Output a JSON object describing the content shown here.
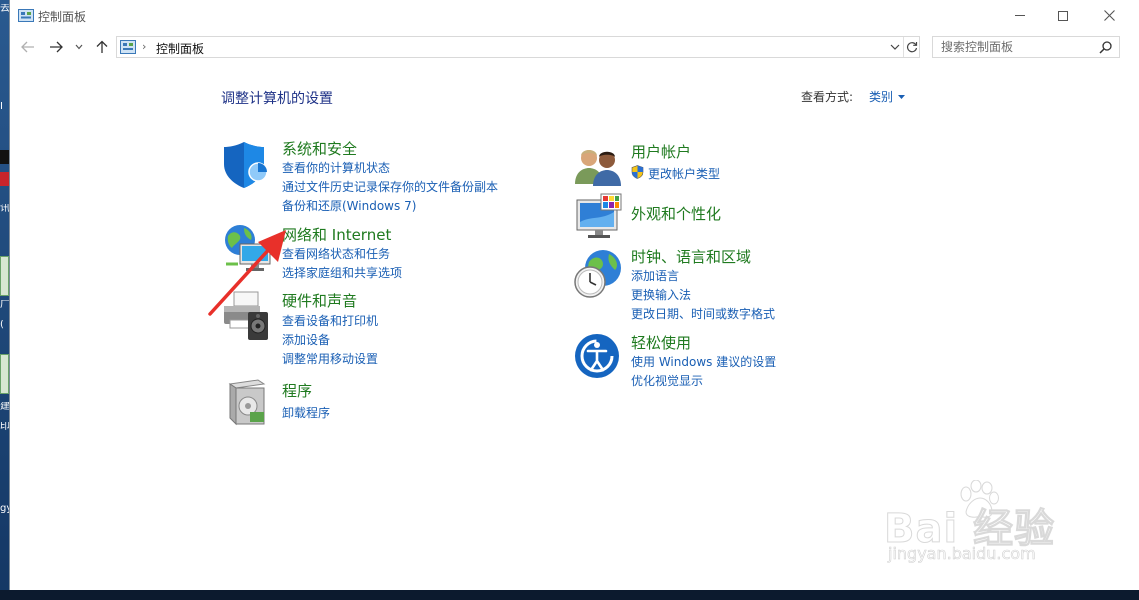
{
  "window": {
    "title": "控制面板"
  },
  "nav": {
    "address": "控制面板",
    "search_placeholder": "搜索控制面板"
  },
  "content": {
    "heading": "调整计算机的设置",
    "view_by_label": "查看方式:",
    "view_by_value": "类别"
  },
  "categories": {
    "system_security": {
      "title": "系统和安全",
      "links": [
        "查看你的计算机状态",
        "通过文件历史记录保存你的文件备份副本",
        "备份和还原(Windows 7)"
      ]
    },
    "network": {
      "title": "网络和 Internet",
      "links": [
        "查看网络状态和任务",
        "选择家庭组和共享选项"
      ]
    },
    "hardware": {
      "title": "硬件和声音",
      "links": [
        "查看设备和打印机",
        "添加设备",
        "调整常用移动设置"
      ]
    },
    "programs": {
      "title": "程序",
      "links": [
        "卸载程序"
      ]
    },
    "user_accounts": {
      "title": "用户帐户",
      "links": [
        "更改帐户类型"
      ]
    },
    "appearance": {
      "title": "外观和个性化",
      "links": []
    },
    "clock_region": {
      "title": "时钟、语言和区域",
      "links": [
        "添加语言",
        "更换输入法",
        "更改日期、时间或数字格式"
      ]
    },
    "ease_access": {
      "title": "轻松使用",
      "links": [
        "使用 Windows 建议的设置",
        "优化视觉显示"
      ]
    }
  },
  "desktop": {
    "fragments": [
      "去",
      "I",
      "讯",
      "广",
      "(",
      "建",
      "印",
      "gy"
    ]
  },
  "watermark": {
    "main": "Bai 经验",
    "sub": "jingyan.baidu.com"
  },
  "colors": {
    "link": "#1a5fb4",
    "category_title": "#1f7a1f",
    "heading": "#1e3287",
    "annotation_arrow": "#e8302a"
  }
}
